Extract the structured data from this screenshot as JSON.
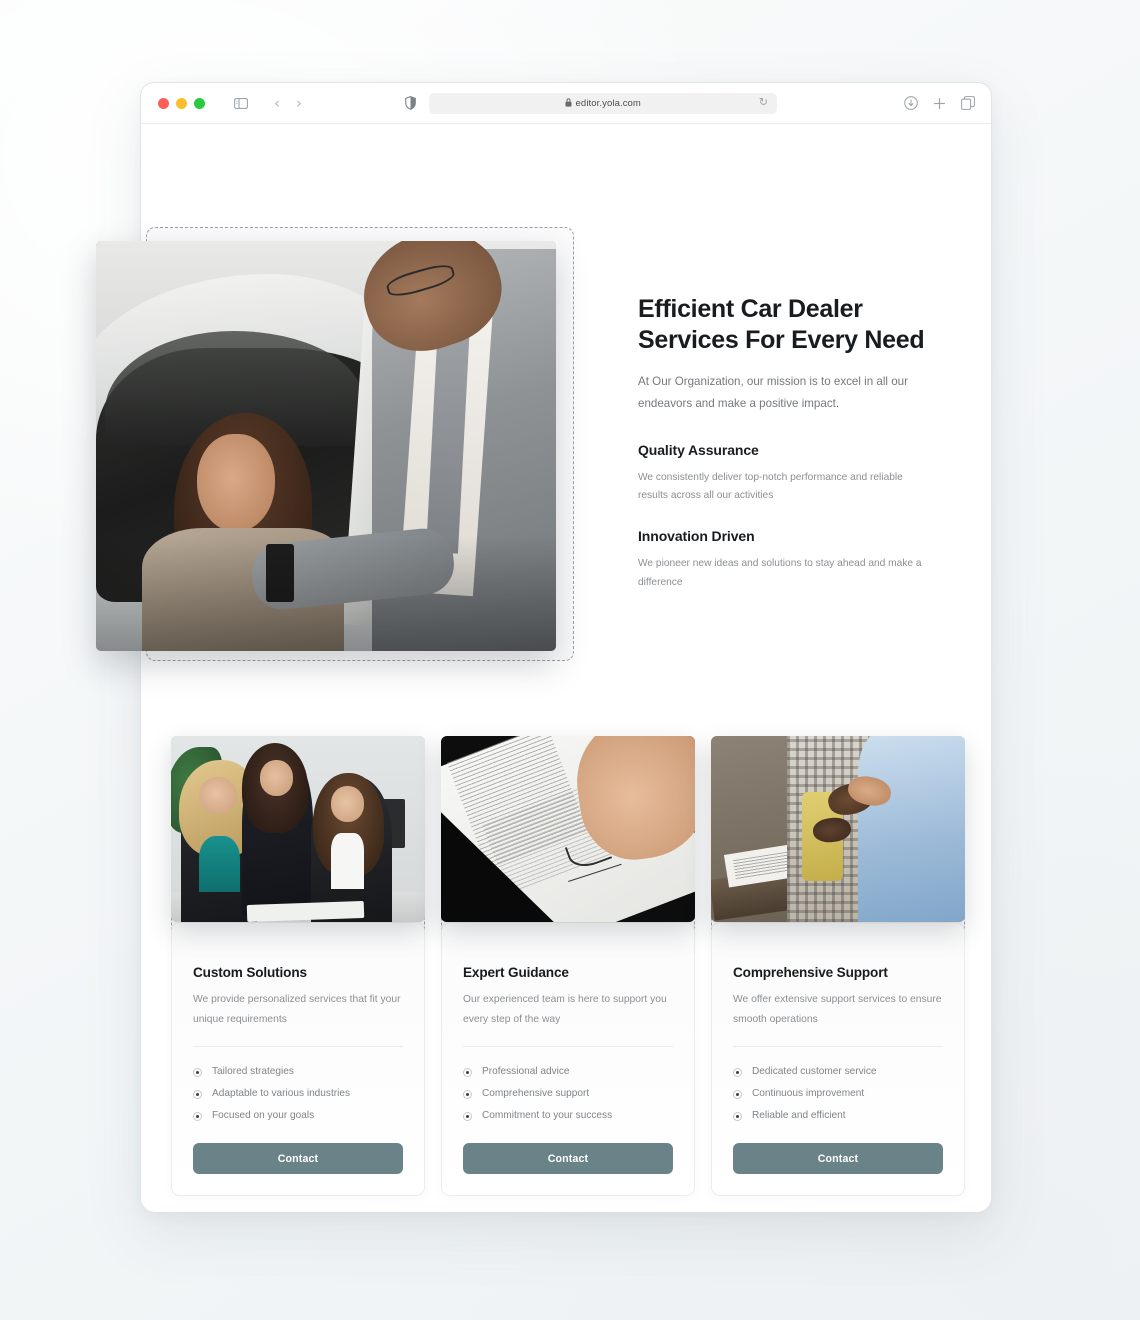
{
  "browser": {
    "traffic_lights": [
      "close",
      "minimize",
      "maximize"
    ],
    "sidebar_icon": "sidebar-icon",
    "back_label": "‹",
    "forward_label": "›",
    "shield_icon": "shield-icon",
    "lock_glyph": "🔒",
    "url": "editor.yola.com",
    "reload_glyph": "↻",
    "download_icon": "download-icon",
    "new_tab_label": "+",
    "tabs_icon": "tab-overview-icon"
  },
  "hero": {
    "title": "Efficient Car Dealer Services For Every Need",
    "subtitle": "At Our Organization, our mission is to excel in all our endeavors and make a positive impact.",
    "image_alt": "Car salesman handing keys to a smiling woman in a white car",
    "features": [
      {
        "title": "Quality Assurance",
        "body": "We consistently deliver top-notch performance and reliable results across all our activities"
      },
      {
        "title": "Innovation Driven",
        "body": "We pioneer new ideas and solutions to stay ahead and make a difference"
      }
    ]
  },
  "cards": [
    {
      "image_alt": "Three businesswomen reviewing documents at a desk",
      "title": "Custom Solutions",
      "description": "We provide personalized services that fit your unique requirements",
      "items": [
        "Tailored strategies",
        "Adaptable to various industries",
        "Focused on your goals"
      ],
      "button_label": "Contact"
    },
    {
      "image_alt": "Hand signing a contract with a fountain pen",
      "title": "Expert Guidance",
      "description": "Our experienced team is here to support you every step of the way",
      "items": [
        "Professional advice",
        "Comprehensive support",
        "Commitment to your success"
      ],
      "button_label": "Contact"
    },
    {
      "image_alt": "Two people shaking hands over a wooden counter",
      "title": "Comprehensive Support",
      "description": "We offer extensive support services to ensure smooth operations",
      "items": [
        "Dedicated customer service",
        "Continuous improvement",
        "Reliable and efficient"
      ],
      "button_label": "Contact"
    }
  ],
  "colors": {
    "accent_button": "#6a8389",
    "heading": "#191c1f",
    "body_text": "#8b8f93",
    "selection_dash": "#9aa0a6",
    "page_background": "#ffffff"
  }
}
